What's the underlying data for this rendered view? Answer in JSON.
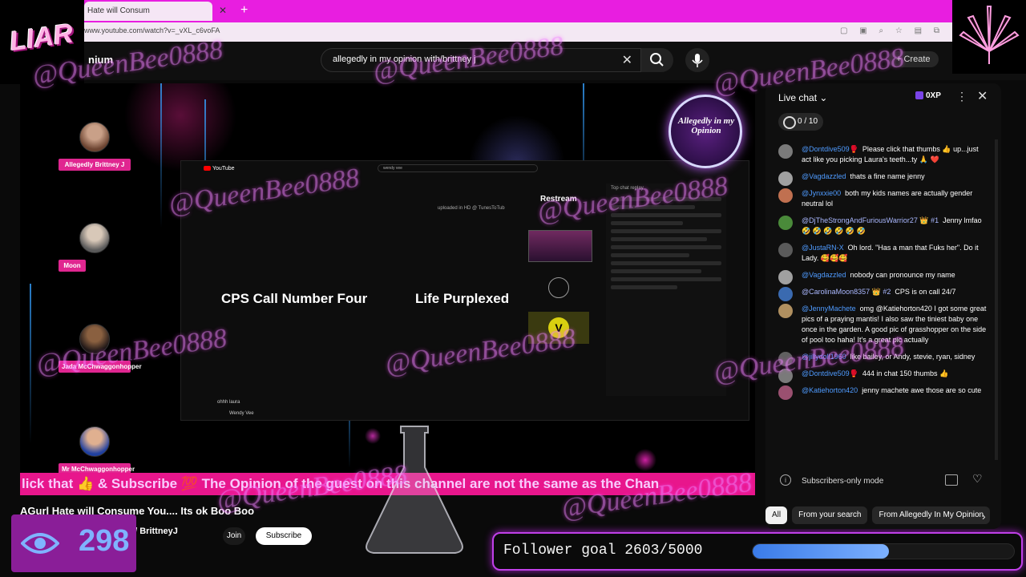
{
  "browser": {
    "tab_title": "Hate will Consum",
    "url": "www.youtube.com/watch?v=_vXL_c6voFA"
  },
  "logos": {
    "liar": "LIAR"
  },
  "header": {
    "brand_fragment": "nium",
    "search_value": "allegedly in my opinion with/brittney j",
    "create_label": "Create"
  },
  "guests": [
    {
      "name": "Allegedly Brittney J"
    },
    {
      "name": "Moon"
    },
    {
      "name": "Jada McChwaggonhopper"
    },
    {
      "name": "Mr McChwaggonhopper"
    }
  ],
  "inner_screen": {
    "search": "wendy vee",
    "uploaded": "uploaded in HD @ TunesToTub",
    "restream": "Restream",
    "topic_a": "CPS Call Number Four",
    "topic_b": "Life Purplexed",
    "chat_head": "Top chat replay",
    "bottom_a": "ohhh laura",
    "bottom_b": "Wendy Vee"
  },
  "badge_text": "Allegedly in my Opinion",
  "ticker_text": "lick that 👍 & Subscribe 💯 The Opinion of the guest on this channel are not the same as the Chan",
  "video": {
    "title": "AGurl Hate will Consume You.... Its ok Boo Boo",
    "channel": "ion w/ BrittneyJ",
    "join_label": "Join",
    "subscribe_label": "Subscribe"
  },
  "viewers": {
    "count": "298"
  },
  "follower_goal": {
    "label": "Follower goal 2603/5000",
    "current": 2603,
    "target": 5000
  },
  "chat": {
    "title": "Live chat ⌄",
    "xp": "0XP",
    "goal": "0 / 10",
    "messages": [
      {
        "author": "@Dontdive509🥊",
        "text": "Please click that thumbs 👍 up...just act like you picking Laura's teeth...ty 🙏 ❤️"
      },
      {
        "author": "@Vagdazzled",
        "text": "thats a fine name jenny"
      },
      {
        "author": "@Jynxxie00",
        "text": "both my kids names are actually gender neutral lol"
      },
      {
        "author": "@DjTheStrongAndFuriousWarrior27 👑 #1",
        "text": "Jenny lmfao 🤣 🤣 🤣 🤣 🤣 🤣",
        "gold": true
      },
      {
        "author": "@JustaRN-X",
        "text": "Oh lord. \"Has a man that Fuks her\". Do it Lady. 🥰🥰🥰"
      },
      {
        "author": "@Vagdazzled",
        "text": "nobody can pronounce my name"
      },
      {
        "author": "@CarolinaMoon8357 👑 #2",
        "text": "CPS is on call 24/7",
        "gold": true
      },
      {
        "author": "@JennyMachete",
        "text": "omg @Katiehorton420 I got some great pics of a praying mantis! I also saw the tiniest baby one once in the garden. A good pic of grasshopper on the side of pool too haha! It's a great pic actually"
      },
      {
        "author": "@jillydoll1960",
        "text": "like bailey, or Andy, stevie, ryan, sidney"
      },
      {
        "author": "@Dontdive509🥊",
        "text": "444 in chat 150 thumbs 👍"
      },
      {
        "author": "@Katiehorton420",
        "text": "jenny machete awe those are so cute"
      }
    ],
    "subscribers_only": "Subscribers-only mode",
    "filters": [
      "All",
      "From your search",
      "From Allegedly In My Opinion"
    ]
  },
  "watermark": "@QueenBee0888",
  "colors": {
    "accent_pink": "#e8168c",
    "goal_blue": "#7db1ff",
    "viewer_purple": "#8a1e98"
  }
}
